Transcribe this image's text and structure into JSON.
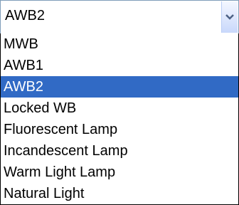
{
  "select": {
    "value": "AWB2",
    "options": [
      {
        "label": "MWB"
      },
      {
        "label": "AWB1"
      },
      {
        "label": "AWB2",
        "selected": true
      },
      {
        "label": "Locked WB"
      },
      {
        "label": "Fluorescent Lamp"
      },
      {
        "label": "Incandescent Lamp"
      },
      {
        "label": "Warm Light Lamp"
      },
      {
        "label": "Natural Light"
      }
    ]
  },
  "colors": {
    "highlight": "#316ac5",
    "border": "#7f9db9"
  },
  "icons": {
    "dropdown": "chevron-down-icon"
  }
}
